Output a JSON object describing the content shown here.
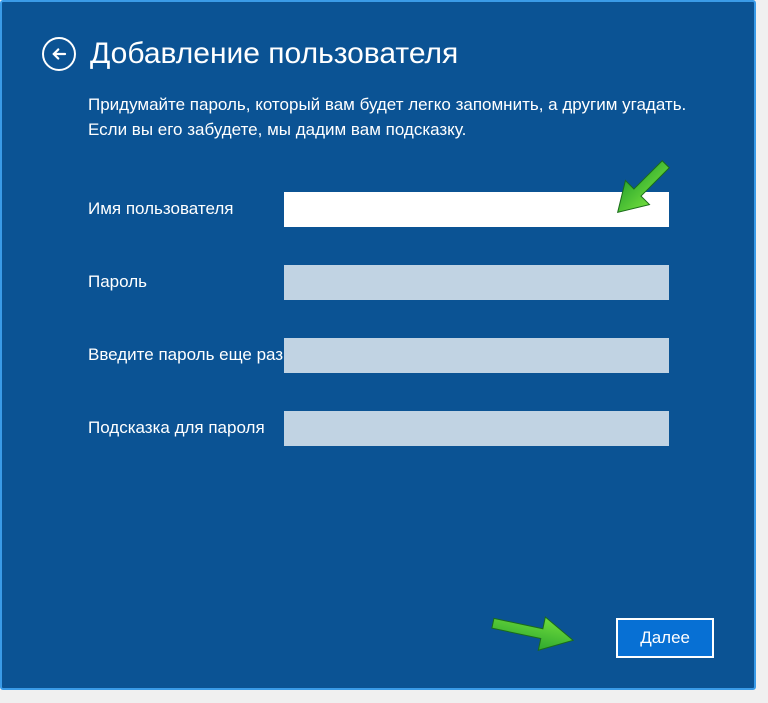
{
  "header": {
    "title": "Добавление пользователя"
  },
  "description": "Придумайте пароль, который вам будет легко запомнить, а другим угадать. Если вы его забудете, мы дадим вам подсказку.",
  "fields": {
    "username": {
      "label": "Имя пользователя",
      "value": ""
    },
    "password": {
      "label": "Пароль",
      "value": ""
    },
    "password_confirm": {
      "label": "Введите пароль еще раз",
      "value": ""
    },
    "password_hint": {
      "label": "Подсказка для пароля",
      "value": ""
    }
  },
  "buttons": {
    "next": "Далее"
  }
}
